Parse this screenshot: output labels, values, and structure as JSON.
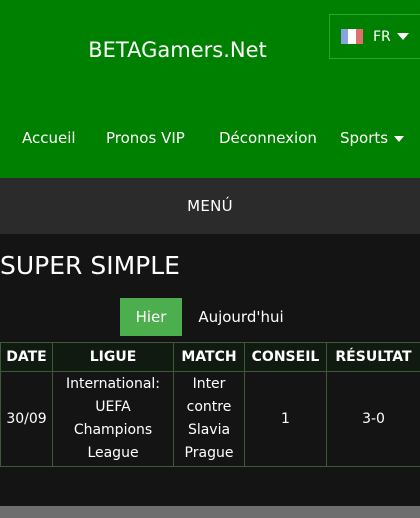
{
  "header": {
    "site_title": "BETAGamers.Net",
    "language": {
      "label": "FR",
      "flag": [
        "#8aa2e0",
        "#ffffff",
        "#e07070"
      ]
    },
    "nav": [
      {
        "label": "Accueil"
      },
      {
        "label": "Pronos VIP"
      },
      {
        "label": "Déconnexion"
      },
      {
        "label": "Sports"
      }
    ]
  },
  "menu_bar": {
    "label": "MENÚ"
  },
  "main": {
    "section_title": "SUPER SIMPLE",
    "tabs": [
      {
        "label": "Hier",
        "active": true
      },
      {
        "label": "Aujourd'hui",
        "active": false
      }
    ],
    "table": {
      "columns": [
        "DATE",
        "LIGUE",
        "MATCH",
        "CONSEIL",
        "RÉSULTAT"
      ],
      "rows": [
        [
          "30/09",
          "International: UEFA Champions League",
          "Inter contre Slavia Prague",
          "1",
          "3-0"
        ]
      ]
    }
  },
  "colors": {
    "header_green": "#008000",
    "active_tab": "#4cae4c",
    "menu_bar": "#2b2b2b",
    "background": "#141414"
  }
}
